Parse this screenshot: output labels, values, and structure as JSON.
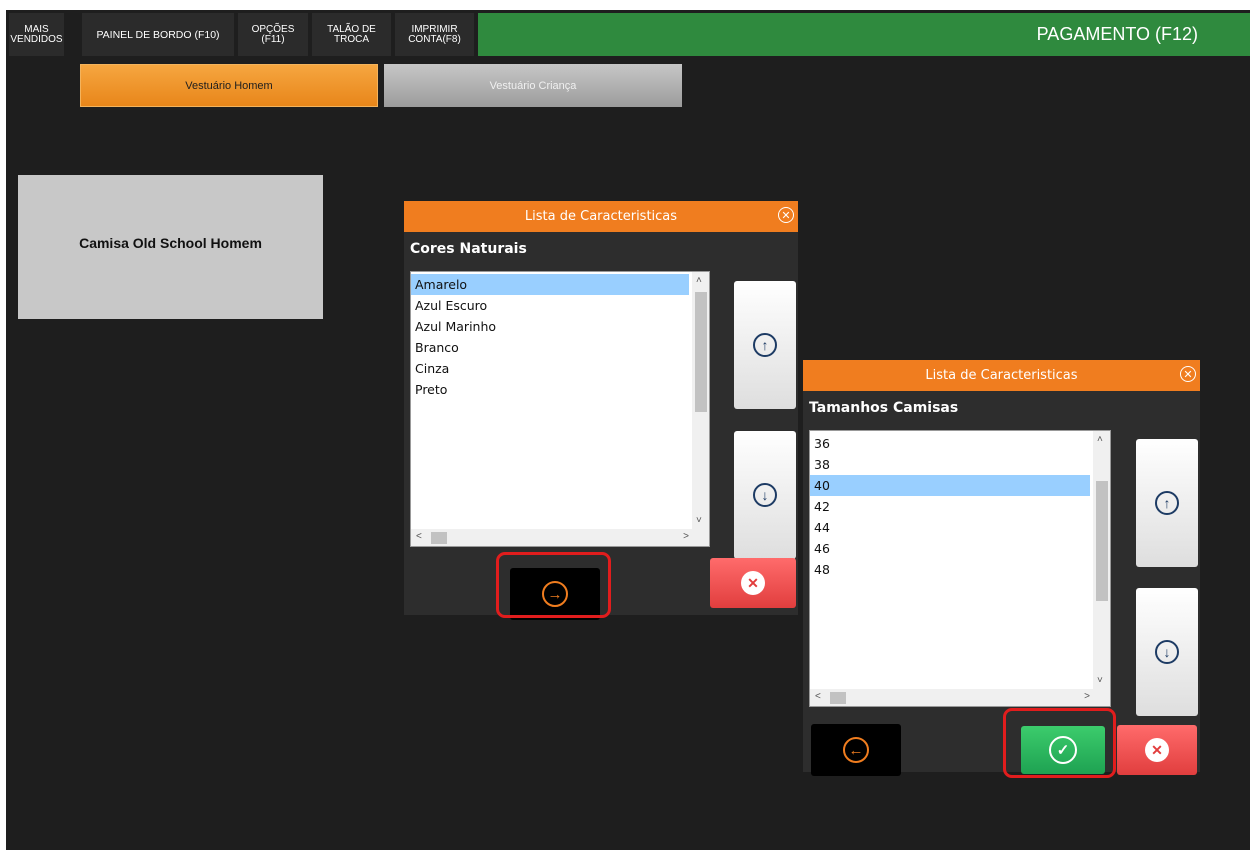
{
  "toolbar": {
    "mais_vendidos": "MAIS\nVENDIDOS",
    "painel_bordo": "PAINEL DE BORDO (F10)",
    "opcoes": "OPÇÕES\n(F11)",
    "talao_troca": "TALÃO DE\nTROCA",
    "imprimir_conta": "IMPRIMIR\nCONTA(F8)",
    "pagamento": "PAGAMENTO (F12)"
  },
  "categories": [
    "Vestuário Homem",
    "Vestuário Criança"
  ],
  "product": "Camisa Old School Homem",
  "dialog_colors": {
    "title": "Lista de Caracteristicas",
    "subtitle": "Cores Naturais",
    "items": [
      "Amarelo",
      "Azul Escuro",
      "Azul Marinho",
      "Branco",
      "Cinza",
      "Preto"
    ],
    "selected": "Amarelo"
  },
  "dialog_sizes": {
    "title": "Lista de Caracteristicas",
    "subtitle": "Tamanhos Camisas",
    "items": [
      "36",
      "38",
      "40",
      "42",
      "44",
      "46",
      "48"
    ],
    "selected": "40"
  },
  "colors": {
    "accent_orange": "#f07d1f",
    "pay_green": "#2f8a3e",
    "confirm_green": "#1ea252",
    "cancel_red": "#e13e3e",
    "highlight_red": "#e11d1d",
    "selection_blue": "#99cfff"
  },
  "icons": {
    "up": "arrow-up-circle-icon",
    "down": "arrow-down-circle-icon",
    "next": "arrow-right-circle-icon",
    "back": "arrow-left-circle-icon",
    "confirm": "check-circle-icon",
    "cancel": "x-circle-icon",
    "close": "close-icon"
  }
}
